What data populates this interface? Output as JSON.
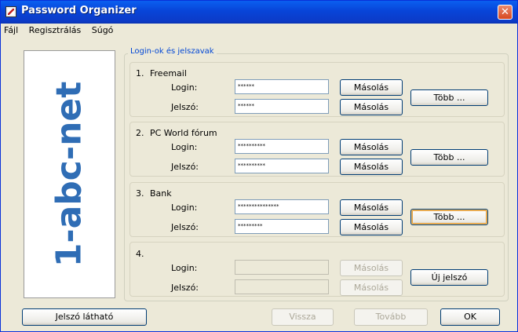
{
  "window": {
    "title": "Password Organizer",
    "close_glyph": "✕"
  },
  "menu": [
    "Fájl",
    "Regisztrálás",
    "Súgó"
  ],
  "logo_text": "1-abc-net",
  "group_title": "Login-ok és jelszavak",
  "labels": {
    "login": "Login:",
    "password": "Jelszó:"
  },
  "entries": [
    {
      "number": "1.",
      "service": "Freemail",
      "login_value": "******",
      "password_value": "******",
      "copy_login": "Másolás",
      "copy_password": "Másolás",
      "more": "Több ..."
    },
    {
      "number": "2.",
      "service": "PC World fórum",
      "login_value": "**********",
      "password_value": "**********",
      "copy_login": "Másolás",
      "copy_password": "Másolás",
      "more": "Több ..."
    },
    {
      "number": "3.",
      "service": "Bank",
      "login_value": "***************",
      "password_value": "*********",
      "copy_login": "Másolás",
      "copy_password": "Másolás",
      "more": "Több ..."
    },
    {
      "number": "4.",
      "service": "",
      "login_value": "",
      "password_value": "",
      "copy_login": "Másolás",
      "copy_password": "Másolás",
      "more": "Új jelszó"
    }
  ],
  "bottom": {
    "show_password": "Jelszó látható",
    "back": "Vissza",
    "next": "Tovább",
    "ok": "OK"
  },
  "colors": {
    "title_bar": "#0844d8",
    "group_title": "#0046d5",
    "logo_blue": "#2f6db5",
    "logo_red": "#d82020"
  }
}
